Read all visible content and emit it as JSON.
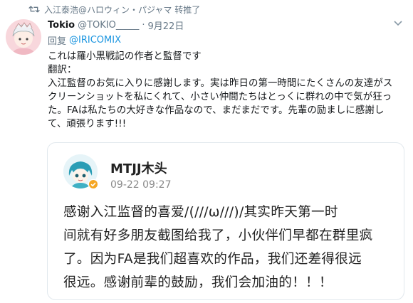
{
  "retweet": {
    "text": "入江泰浩@ハロウィン・パジャマ 转推了",
    "icon": "retweet-icon"
  },
  "tweet": {
    "display_name": "Tokio",
    "handle": "@TOKIO_____",
    "separator": "·",
    "date": "9月22日",
    "reply_label": "回复",
    "reply_to": "@IRICOMIX",
    "text_lines": [
      "これは羅小黒戦記の作者と監督です",
      "翻訳：",
      "入江監督のお気に入りに感謝します。実は昨日の第一時間にたくさんの友達がス",
      "クリーンショットを私にくれて、小さい仲間たちはとっくに群れの中で気が狂っ",
      "た。FAは私たちの大好きな作品なので、まだまだです。先輩の励ましに感謝し",
      "て、頑張ります!!!"
    ],
    "more_icon": "chevron-down-icon"
  },
  "quote": {
    "name": "MTJJ木头",
    "time": "09-22 09:27",
    "badge_icon": "verified-badge-icon",
    "body_lines": [
      "感谢入江监督的喜爱/(///ω///)/其实昨天第一时",
      "间就有好多朋友截图给我了，小伙伴们早都在群里疯",
      "了。因为FA是我们超喜欢的作品，我们还差得很远",
      "很远。感谢前辈的鼓励，我们会加油的！！！"
    ]
  },
  "colors": {
    "link": "#1b95e0",
    "secondary_text": "#657786",
    "border": "#e1e8ed",
    "badge": "#f5a623"
  }
}
